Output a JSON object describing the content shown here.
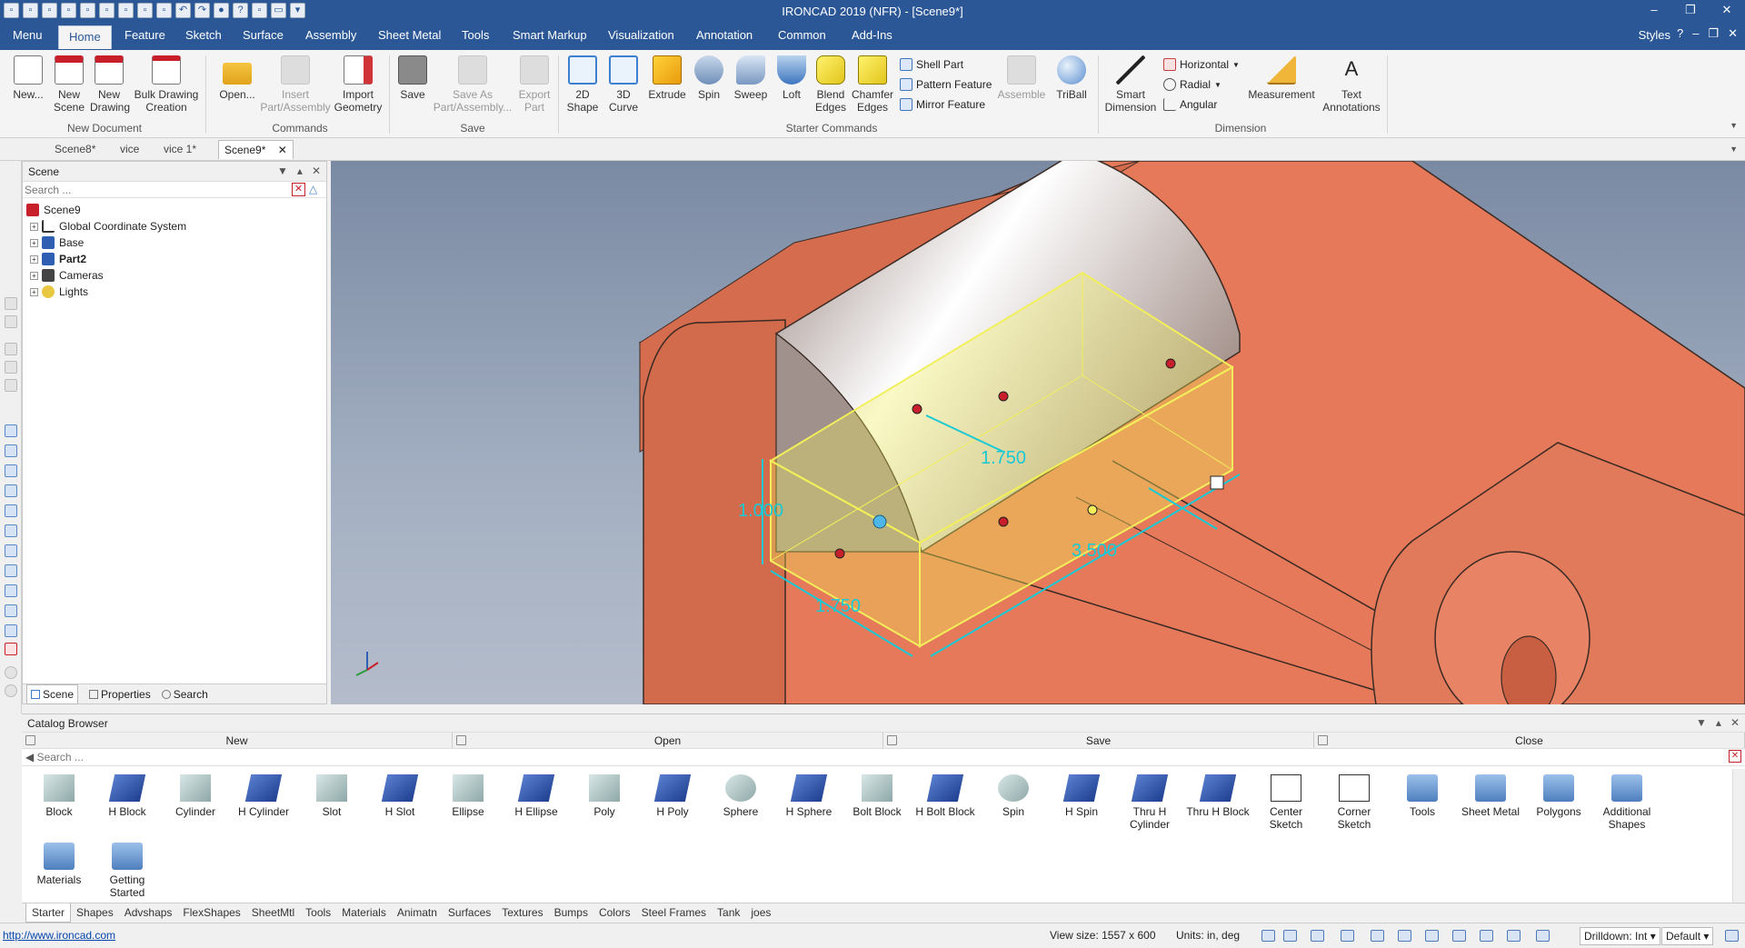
{
  "app": {
    "title": "IRONCAD 2019 (NFR) - [Scene9*]",
    "brand_color": "#2b5797"
  },
  "quick_access": [
    "new-icon",
    "new-scene-icon",
    "open-icon",
    "new-drawing-icon",
    "save-icon",
    "save-all-icon",
    "print-icon",
    "export-icon",
    "import-icon",
    "undo-icon",
    "redo-icon",
    "web-icon",
    "help-icon",
    "view-icon",
    "layout-icon",
    "customize-icon"
  ],
  "menubar": {
    "tabs": [
      "Menu",
      "Home",
      "Feature",
      "Sketch",
      "Surface",
      "Assembly",
      "Sheet Metal",
      "Tools",
      "Smart Markup",
      "Visualization",
      "Annotation",
      "Common",
      "Add-Ins"
    ],
    "active": "Home",
    "styles_label": "Styles"
  },
  "ribbon": {
    "new_document": {
      "label": "New Document",
      "buttons": [
        {
          "label": "New...",
          "icon": "new-document-icon"
        },
        {
          "label": "New Scene",
          "icon": "new-scene-icon"
        },
        {
          "label": "New Drawing",
          "icon": "new-drawing-icon"
        },
        {
          "label": "Bulk Drawing Creation",
          "icon": "bulk-drawing-icon"
        }
      ]
    },
    "commands": {
      "label": "Commands",
      "buttons": [
        {
          "label": "Open...",
          "icon": "open-folder-icon",
          "disabled": false
        },
        {
          "label": "Insert Part/Assembly",
          "icon": "insert-part-icon",
          "disabled": true
        },
        {
          "label": "Import Geometry",
          "icon": "import-geometry-icon",
          "disabled": false
        }
      ]
    },
    "save": {
      "label": "Save",
      "buttons": [
        {
          "label": "Save",
          "icon": "save-icon",
          "disabled": false
        },
        {
          "label": "Save As Part/Assembly...",
          "icon": "save-as-icon",
          "disabled": true
        },
        {
          "label": "Export Part",
          "icon": "export-part-icon",
          "disabled": true
        }
      ]
    },
    "starter": {
      "label": "Starter Commands",
      "buttons": [
        {
          "label": "2D Shape",
          "icon": "2d-shape-icon"
        },
        {
          "label": "3D Curve",
          "icon": "3d-curve-icon"
        },
        {
          "label": "Extrude",
          "icon": "extrude-icon"
        },
        {
          "label": "Spin",
          "icon": "spin-icon"
        },
        {
          "label": "Sweep",
          "icon": "sweep-icon"
        },
        {
          "label": "Loft",
          "icon": "loft-icon"
        },
        {
          "label": "Blend Edges",
          "icon": "blend-edges-icon"
        },
        {
          "label": "Chamfer Edges",
          "icon": "chamfer-edges-icon"
        }
      ],
      "small": [
        "Shell Part",
        "Pattern Feature",
        "Mirror Feature"
      ],
      "assemble": "Assemble",
      "triball": "TriBall"
    },
    "dimension": {
      "label": "Dimension",
      "smart": "Smart Dimension",
      "small": [
        "Horizontal",
        "Radial",
        "Angular"
      ],
      "measurement": "Measurement",
      "text_annotations": "Text Annotations"
    }
  },
  "doc_tabs": [
    "Scene8*",
    "vice",
    "vice 1*",
    "Scene9*"
  ],
  "doc_tabs_active": "Scene9*",
  "scene_panel": {
    "title": "Scene",
    "search_placeholder": "Search ...",
    "root": "Scene9",
    "items": [
      {
        "label": "Global Coordinate System",
        "icon": "coordinate-system-icon",
        "bold": false
      },
      {
        "label": "Base",
        "icon": "part-icon",
        "bold": false
      },
      {
        "label": "Part2",
        "icon": "part-icon",
        "bold": true
      },
      {
        "label": "Cameras",
        "icon": "camera-icon",
        "bold": false
      },
      {
        "label": "Lights",
        "icon": "light-icon",
        "bold": false
      }
    ],
    "bottom_tabs": [
      "Scene",
      "Properties",
      "Search"
    ]
  },
  "viewport": {
    "dimensions": [
      "1.750",
      "1.000",
      "1.750",
      "3.500"
    ],
    "dim_color": "#19c9d6",
    "highlight_color": "#f2ef5a",
    "part_color": "#e5795a"
  },
  "catalog": {
    "title": "Catalog Browser",
    "actions": [
      "New",
      "Open",
      "Save",
      "Close"
    ],
    "search_placeholder": "Search ...",
    "items": [
      {
        "label": "Block",
        "icon": "block-icon"
      },
      {
        "label": "H Block",
        "icon": "h-block-icon"
      },
      {
        "label": "Cylinder",
        "icon": "cylinder-icon"
      },
      {
        "label": "H Cylinder",
        "icon": "h-cylinder-icon"
      },
      {
        "label": "Slot",
        "icon": "slot-icon"
      },
      {
        "label": "H Slot",
        "icon": "h-slot-icon"
      },
      {
        "label": "Ellipse",
        "icon": "ellipse-icon"
      },
      {
        "label": "H Ellipse",
        "icon": "h-ellipse-icon"
      },
      {
        "label": "Poly",
        "icon": "poly-icon"
      },
      {
        "label": "H Poly",
        "icon": "h-poly-icon"
      },
      {
        "label": "Sphere",
        "icon": "sphere-icon"
      },
      {
        "label": "H Sphere",
        "icon": "h-sphere-icon"
      },
      {
        "label": "Bolt Block",
        "icon": "bolt-block-icon"
      },
      {
        "label": "H Bolt Block",
        "icon": "h-bolt-block-icon"
      },
      {
        "label": "Spin",
        "icon": "spin-icon"
      },
      {
        "label": "H Spin",
        "icon": "h-spin-icon"
      },
      {
        "label": "Thru H Cylinder",
        "icon": "thru-h-cylinder-icon"
      },
      {
        "label": "Thru H Block",
        "icon": "thru-h-block-icon"
      },
      {
        "label": "Center Sketch",
        "icon": "center-sketch-icon"
      },
      {
        "label": "Corner Sketch",
        "icon": "corner-sketch-icon"
      },
      {
        "label": "Tools",
        "icon": "folder-icon"
      },
      {
        "label": "Sheet Metal",
        "icon": "folder-icon"
      },
      {
        "label": "Polygons",
        "icon": "folder-icon"
      },
      {
        "label": "Additional Shapes",
        "icon": "folder-icon"
      },
      {
        "label": "Materials",
        "icon": "folder-icon"
      },
      {
        "label": "Getting Started",
        "icon": "folder-icon"
      }
    ],
    "tabs": [
      "Starter",
      "Shapes",
      "Advshaps",
      "FlexShapes",
      "SheetMtl",
      "Tools",
      "Materials",
      "Animatn",
      "Surfaces",
      "Textures",
      "Bumps",
      "Colors",
      "Steel Frames",
      "Tank",
      "joes"
    ],
    "active_tab": "Starter"
  },
  "status": {
    "url": "http://www.ironcad.com",
    "view_size": "View size: 1557 x  600",
    "units": "Units: in, deg",
    "drilldown": "Drilldown: Int",
    "default": "Default"
  }
}
